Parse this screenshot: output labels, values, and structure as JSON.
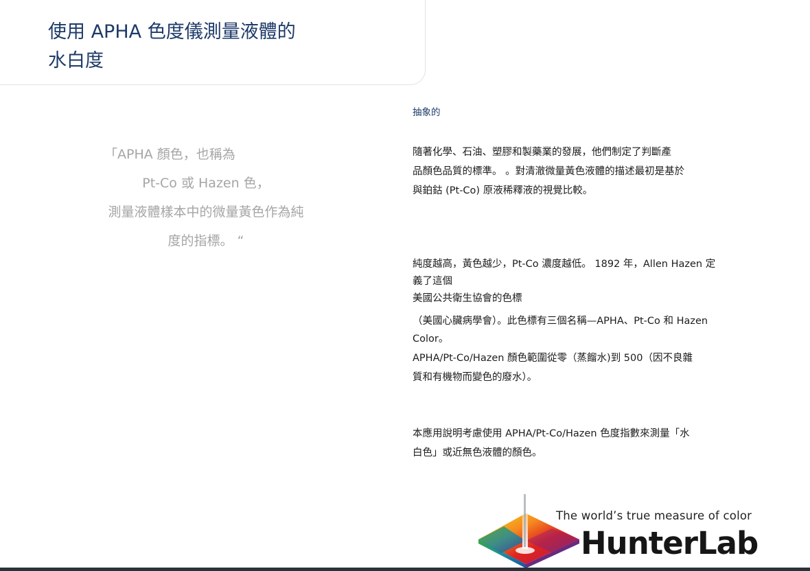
{
  "title": {
    "lines": [
      "使用 APHA 色度儀測量液體的",
      "水白度"
    ]
  },
  "quote": {
    "lines": [
      "「APHA 顏色，也稱為",
      "Pt-Co 或 Hazen 色，",
      "測量液體樣本中的微量黃色作為純",
      "度的指標。 “"
    ]
  },
  "abstract": {
    "heading": "抽象的",
    "p1": [
      "隨著化學、石油、塑膠和製藥業的發展，他們制定了判斷產",
      "品顏色品質的標準。 。對清澈微量黃色液體的描述最初是基於",
      "與鉑鈷 (Pt-Co) 原液稀釋液的視覺比較。"
    ],
    "p2": [
      "純度越高，黃色越少，Pt-Co 濃度越低。 1892 年，Allen Hazen 定",
      "義了這個",
      "美國公共衛生協會的色標"
    ],
    "p3": [
      "（美國心臟病學會）。此色標有三個名稱—APHA、Pt-Co 和 Hazen",
      "Color。"
    ],
    "p4": [
      "APHA/Pt-Co/Hazen 顏色範圍從零（蒸餾水)到 500（因不良雜",
      "質和有機物而變色的廢水）。"
    ],
    "p5": [
      "本應用說明考慮使用 APHA/Pt-Co/Hazen 色度指數來測量「水",
      "白色」或近無色液體的顏色。"
    ]
  },
  "logo": {
    "tagline": "The world’s true measure of color",
    "brand": "HunterLab"
  },
  "colors": {
    "title": "#1d3a68",
    "quote": "#a5a5a5",
    "body_text": "#1c1c1c",
    "bottom_bar": "#2a323a"
  }
}
